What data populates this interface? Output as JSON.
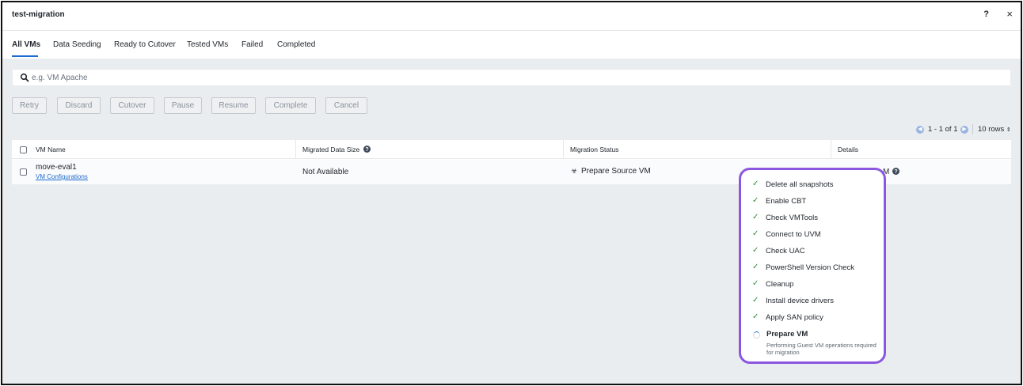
{
  "window": {
    "title": "test-migration",
    "help_label": "?",
    "close_label": "×"
  },
  "tabs": [
    {
      "label": "All VMs",
      "active": true
    },
    {
      "label": "Data Seeding"
    },
    {
      "label": "Ready to Cutover"
    },
    {
      "label": "Tested VMs"
    },
    {
      "label": "Failed"
    },
    {
      "label": "Completed"
    }
  ],
  "search": {
    "placeholder": "e.g. VM Apache",
    "value": ""
  },
  "actions": [
    "Retry",
    "Discard",
    "Cutover",
    "Pause",
    "Resume",
    "Complete",
    "Cancel"
  ],
  "pagination": {
    "range": "1 - 1 of 1",
    "rows_label": "10 rows"
  },
  "table": {
    "columns": [
      "VM Name",
      "Migrated Data Size",
      "Migration Status",
      "Details"
    ],
    "rows": [
      {
        "vm_name": "move-eval1",
        "vm_link": "VM Configurations",
        "data_size": "Not Available",
        "status": "Prepare Source VM",
        "details_partial": "M"
      }
    ]
  },
  "steps": [
    {
      "label": "Delete all snapshots",
      "state": "done"
    },
    {
      "label": "Enable CBT",
      "state": "done"
    },
    {
      "label": "Check VMTools",
      "state": "done"
    },
    {
      "label": "Connect to UVM",
      "state": "done"
    },
    {
      "label": "Check UAC",
      "state": "done"
    },
    {
      "label": "PowerShell Version Check",
      "state": "done"
    },
    {
      "label": "Cleanup",
      "state": "done"
    },
    {
      "label": "Install device drivers",
      "state": "done"
    },
    {
      "label": "Apply SAN policy",
      "state": "done"
    },
    {
      "label": "Prepare VM",
      "state": "in-progress",
      "description": "Performing Guest VM operations required for migration"
    }
  ],
  "colors": {
    "accent": "#1b6bd1",
    "highlight": "#8b57e0",
    "success": "#2e8b3b"
  }
}
